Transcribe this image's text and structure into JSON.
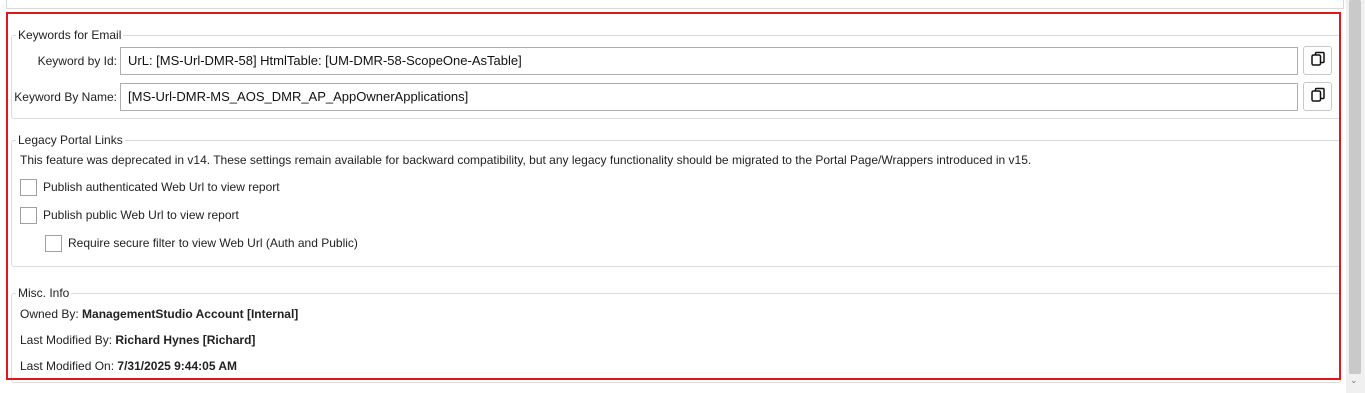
{
  "keywords_section": {
    "title": "Keywords for Email",
    "keyword_by_id": {
      "label": "Keyword by Id:",
      "value": "UrL: [MS-Url-DMR-58] HtmlTable: [UM-DMR-58-ScopeOne-AsTable]"
    },
    "keyword_by_name": {
      "label": "Keyword By Name:",
      "value": "[MS-Url-DMR-MS_AOS_DMR_AP_AppOwnerApplications]"
    },
    "copy_icon": "copy-icon"
  },
  "legacy_section": {
    "title": "Legacy Portal Links",
    "notice": "This feature was deprecated in v14. These settings remain available for backward compatibility, but any legacy functionality should be migrated to the Portal Page/Wrappers introduced in v15.",
    "options": [
      {
        "label": "Publish authenticated Web Url to view report",
        "checked": false
      },
      {
        "label": "Publish public Web Url to view report",
        "checked": false
      },
      {
        "label": "Require secure filter to view Web Url (Auth and Public)",
        "checked": false
      }
    ]
  },
  "misc_section": {
    "title": "Misc. Info",
    "owned_by": {
      "label": "Owned By:",
      "value": "ManagementStudio Account [Internal]"
    },
    "last_modified_by": {
      "label": "Last Modified By:",
      "value": "Richard Hynes [Richard]"
    },
    "last_modified_on": {
      "label": "Last Modified On:",
      "value": "7/31/2025 9:44:05 AM"
    }
  },
  "colors": {
    "highlight_border": "#e0161b",
    "group_border": "#dcdcdc"
  }
}
